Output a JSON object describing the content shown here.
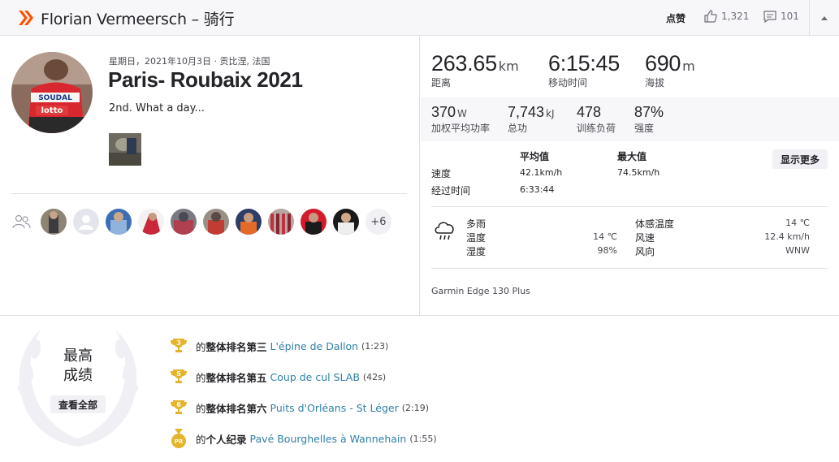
{
  "header": {
    "title": "Florian Vermeersch – 骑行",
    "kudos_label": "点赞",
    "kudos_count": "1,321",
    "comment_count": "101"
  },
  "activity": {
    "meta": "星期日，2021年10月3日 · 贡比涅, 法国",
    "title": "Paris- Roubaix 2021",
    "description": "2nd. What a day...",
    "more_athletes": "+6"
  },
  "primary_stats": [
    {
      "value": "263.65",
      "unit": "km",
      "label": "距离"
    },
    {
      "value": "6:15:45",
      "unit": "",
      "label": "移动时间"
    },
    {
      "value": "690",
      "unit": "m",
      "label": "海拔"
    }
  ],
  "secondary_stats": [
    {
      "value": "370",
      "unit": "W",
      "label": "加权平均功率"
    },
    {
      "value": "7,743",
      "unit": "kJ",
      "label": "总功"
    },
    {
      "value": "478",
      "unit": "",
      "label": "训练负荷"
    },
    {
      "value": "87%",
      "unit": "",
      "label": "强度"
    }
  ],
  "table": {
    "col_avg": "平均值",
    "col_max": "最大值",
    "show_more": "显示更多",
    "rows": [
      {
        "label": "速度",
        "avg": "42.1km/h",
        "max": "74.5km/h"
      },
      {
        "label": "经过时间",
        "avg": "6:33:44",
        "max": ""
      }
    ]
  },
  "weather": {
    "icon": "cloud-rain-icon",
    "left": [
      {
        "label": "多雨",
        "value": ""
      },
      {
        "label": "温度",
        "value": "14 ℃"
      },
      {
        "label": "湿度",
        "value": "98%"
      }
    ],
    "right": [
      {
        "label": "体感温度",
        "value": "14 ℃"
      },
      {
        "label": "风速",
        "value": "12.4 km/h"
      },
      {
        "label": "风向",
        "value": "WNW"
      }
    ]
  },
  "device": "Garmin Edge 130 Plus",
  "best_efforts": {
    "title_line1": "最高",
    "title_line2": "成绩",
    "view_all": "查看全部",
    "items": [
      {
        "icon": "trophy-3",
        "badge": "3",
        "prefix": "的",
        "rank": "整体排名第三",
        "segment": "L'épine de Dallon",
        "time": "(1:23)"
      },
      {
        "icon": "trophy-5",
        "badge": "5",
        "prefix": "的",
        "rank": "整体排名第五",
        "segment": "Coup de cul SLAB",
        "time": "(42s)"
      },
      {
        "icon": "trophy-6",
        "badge": "6",
        "prefix": "的",
        "rank": "整体排名第六",
        "segment": "Puits d'Orléans - St Léger",
        "time": "(2:19)"
      },
      {
        "icon": "pr-medal",
        "badge": "PR",
        "prefix": "的",
        "rank": "个人纪录",
        "segment": "Pavé Bourghelles à Wannehain",
        "time": "(1:55)"
      }
    ]
  },
  "colors": {
    "brand": "#fc5200",
    "link": "#2f7fa8",
    "trophy": "#e6b42a"
  }
}
